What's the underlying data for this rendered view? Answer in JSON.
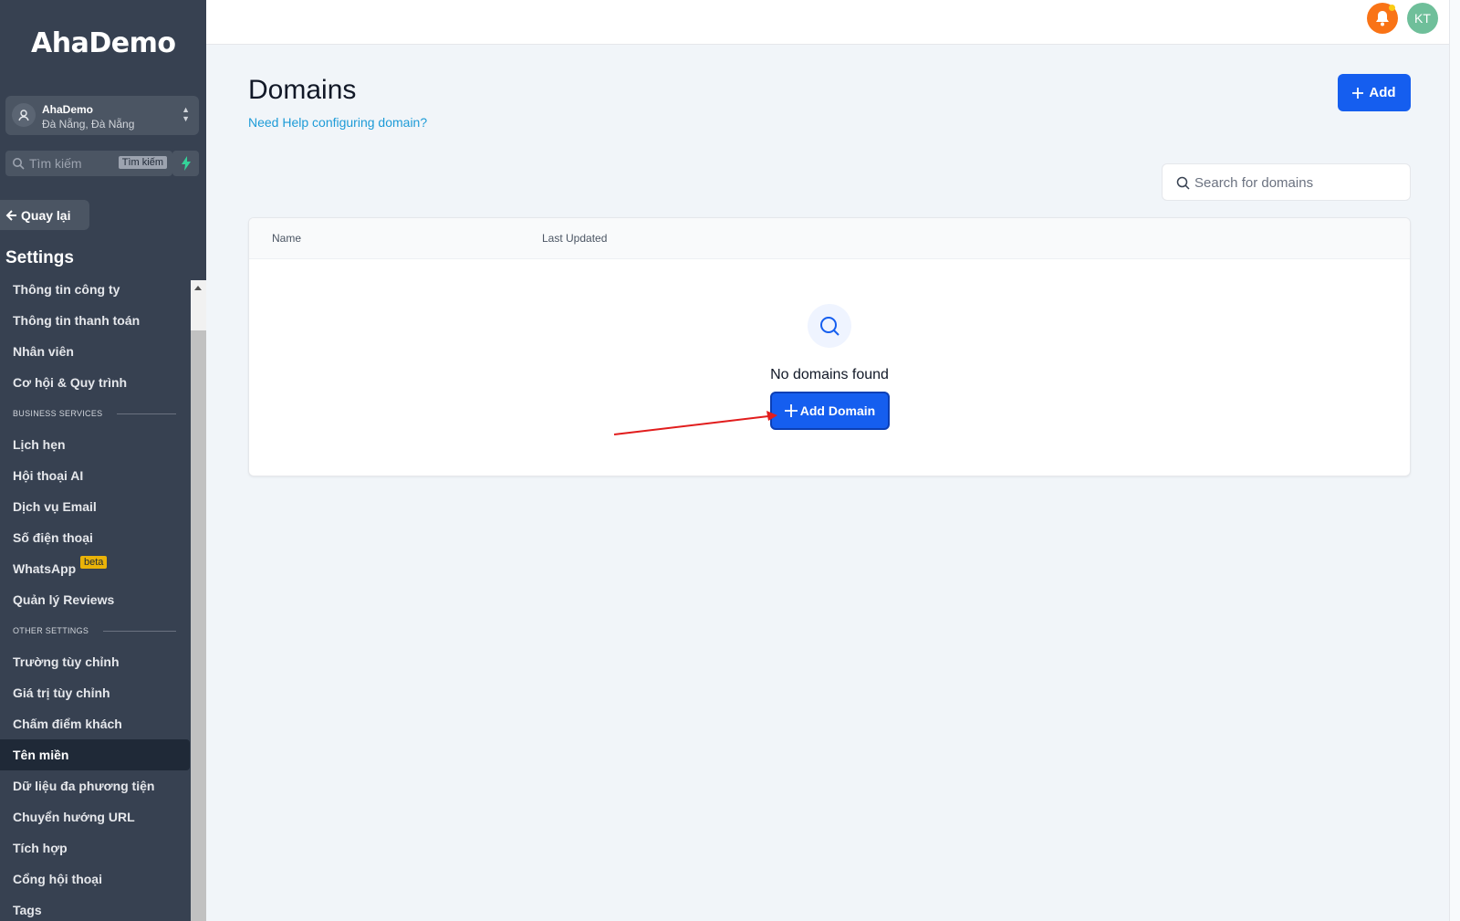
{
  "sidebar": {
    "logo": "AhaDemo",
    "location": {
      "name": "AhaDemo",
      "address": "Đà Nẵng, Đà Nẵng"
    },
    "search": {
      "placeholder": "Tìm kiếm",
      "shortcut": "Tìm kiếm"
    },
    "back_label": "Quay lại",
    "settings_title": "Settings",
    "items_top": [
      "Thông tin công ty",
      "Thông tin thanh toán",
      "Nhân viên",
      "Cơ hội & Quy trình"
    ],
    "section_business": "BUSINESS SERVICES",
    "items_business": [
      "Lịch hẹn",
      "Hội thoại AI",
      "Dịch vụ Email",
      "Số điện thoại",
      "WhatsApp",
      "Quản lý Reviews"
    ],
    "whatsapp_badge": "beta",
    "section_other": "OTHER SETTINGS",
    "items_other": [
      "Trường tùy chỉnh",
      "Giá trị tùy chỉnh",
      "Chấm điểm khách",
      "Tên miền",
      "Dữ liệu đa phương tiện",
      "Chuyển hướng URL",
      "Tích hợp",
      "Cổng hội thoại",
      "Tags"
    ],
    "active_item": "Tên miền"
  },
  "header": {
    "avatar_initials": "KT"
  },
  "main": {
    "title": "Domains",
    "help_link": "Need Help configuring domain?",
    "add_label": "Add",
    "search_placeholder": "Search for domains",
    "table": {
      "columns": [
        "Name",
        "Last Updated"
      ],
      "rows": [],
      "empty_text": "No domains found",
      "empty_button": "Add Domain"
    }
  },
  "colors": {
    "sidebar_bg": "#374151",
    "primary": "#155eef",
    "link": "#1d9bd7",
    "notification": "#f97316",
    "avatar": "#6fbf9a",
    "beta_badge": "#eab308",
    "annotation_arrow": "#e11d1d"
  },
  "icons": [
    "user-location-icon",
    "chevron-updown-icon",
    "search-icon",
    "bolt-icon",
    "arrow-left-icon",
    "bell-icon",
    "plus-icon",
    "magnifier-empty-icon"
  ]
}
